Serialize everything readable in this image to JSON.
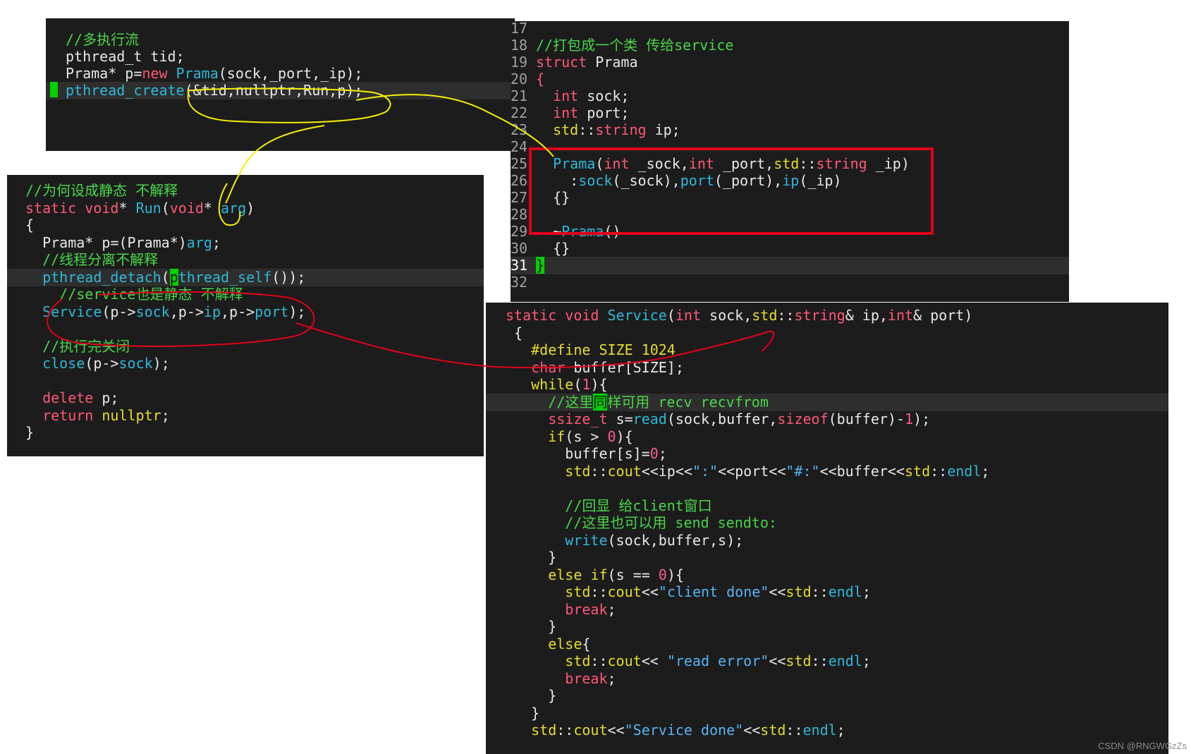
{
  "panels": [
    {
      "id": "panel-main-thread",
      "gutter": false,
      "lines": [
        {
          "tokens": [
            [
              "cm",
              "//多执行流"
            ]
          ],
          "indent": 0
        },
        {
          "tokens": [
            [
              "t",
              "pthread_t tid;"
            ]
          ],
          "indent": 0
        },
        {
          "tokens": [
            [
              "t",
              "Prama* p="
            ],
            [
              "ty",
              "new"
            ],
            [
              "t",
              " "
            ],
            [
              "fn",
              "Prama"
            ],
            [
              "t",
              "(sock,_port,_ip);"
            ]
          ],
          "indent": 0
        },
        {
          "tokens": [
            [
              "fn",
              "pthread_create"
            ],
            [
              "t",
              "(&tid,nullptr,Run,p);"
            ]
          ],
          "indent": 0,
          "highlight": true,
          "marker": true
        }
      ]
    },
    {
      "id": "panel-prama-struct",
      "gutter": true,
      "lines": [
        {
          "num": "17",
          "tokens": []
        },
        {
          "num": "18",
          "tokens": [
            [
              "cm",
              "//打包成一个类 传给service"
            ]
          ]
        },
        {
          "num": "19",
          "tokens": [
            [
              "ty",
              "struct"
            ],
            [
              "t",
              " Prama"
            ]
          ]
        },
        {
          "num": "20",
          "tokens": [
            [
              "ty",
              "{"
            ]
          ]
        },
        {
          "num": "21",
          "tokens": [
            [
              "t",
              "  "
            ],
            [
              "ty",
              "int"
            ],
            [
              "t",
              " sock;"
            ]
          ]
        },
        {
          "num": "22",
          "tokens": [
            [
              "t",
              "  "
            ],
            [
              "ty",
              "int"
            ],
            [
              "t",
              " port;"
            ]
          ]
        },
        {
          "num": "23",
          "tokens": [
            [
              "t",
              "  "
            ],
            [
              "kw",
              "std"
            ],
            [
              "t",
              "::"
            ],
            [
              "ty",
              "string"
            ],
            [
              "t",
              " ip;"
            ]
          ]
        },
        {
          "num": "24",
          "tokens": []
        },
        {
          "num": "25",
          "tokens": [
            [
              "t",
              "  "
            ],
            [
              "fn",
              "Prama"
            ],
            [
              "t",
              "("
            ],
            [
              "ty",
              "int"
            ],
            [
              "t",
              " _sock,"
            ],
            [
              "ty",
              "int"
            ],
            [
              "t",
              " _port,"
            ],
            [
              "kw",
              "std"
            ],
            [
              "t",
              "::"
            ],
            [
              "ty",
              "string"
            ],
            [
              "t",
              " _ip)"
            ]
          ]
        },
        {
          "num": "26",
          "tokens": [
            [
              "t",
              "    :"
            ],
            [
              "fn",
              "sock"
            ],
            [
              "t",
              "(_sock),"
            ],
            [
              "fn",
              "port"
            ],
            [
              "t",
              "(_port),"
            ],
            [
              "fn",
              "ip"
            ],
            [
              "t",
              "(_ip)"
            ]
          ]
        },
        {
          "num": "27",
          "tokens": [
            [
              "t",
              "  {}"
            ]
          ]
        },
        {
          "num": "28",
          "tokens": []
        },
        {
          "num": "29",
          "tokens": [
            [
              "t",
              "  ~"
            ],
            [
              "fn",
              "Prama"
            ],
            [
              "t",
              "()"
            ]
          ]
        },
        {
          "num": "30",
          "tokens": [
            [
              "t",
              "  {}"
            ]
          ]
        },
        {
          "num": "31",
          "tokens": [
            [
              "cur",
              "}"
            ]
          ],
          "highlight": true,
          "numHighlight": true
        },
        {
          "num": "32",
          "tokens": []
        }
      ]
    },
    {
      "id": "panel-run-function",
      "gutter": false,
      "lines": [
        {
          "tokens": [
            [
              "cm",
              "//为何设成静态 不解释"
            ]
          ]
        },
        {
          "tokens": [
            [
              "ty",
              "static"
            ],
            [
              "t",
              " "
            ],
            [
              "ty",
              "void"
            ],
            [
              "t",
              "* "
            ],
            [
              "fn",
              "Run"
            ],
            [
              "t",
              "("
            ],
            [
              "ty",
              "void"
            ],
            [
              "t",
              "* "
            ],
            [
              "fn",
              "arg"
            ],
            [
              "t",
              ")"
            ]
          ]
        },
        {
          "tokens": [
            [
              "t",
              "{"
            ]
          ]
        },
        {
          "tokens": [
            [
              "t",
              "  Prama* p=(Prama*)"
            ],
            [
              "fn",
              "arg"
            ],
            [
              "t",
              ";"
            ]
          ]
        },
        {
          "tokens": [
            [
              "t",
              "  "
            ],
            [
              "cm",
              "//线程分离不解释"
            ]
          ]
        },
        {
          "tokens": [
            [
              "t",
              "  "
            ],
            [
              "fn",
              "pthread_detach"
            ],
            [
              "t",
              "("
            ],
            [
              "cur",
              "p"
            ],
            [
              "fn",
              "thread_self"
            ],
            [
              "t",
              "());"
            ]
          ],
          "highlight": true
        },
        {
          "tokens": [
            [
              "t",
              "    "
            ],
            [
              "cm",
              "//service也是静态 不解释"
            ]
          ]
        },
        {
          "tokens": [
            [
              "t",
              "  "
            ],
            [
              "fn",
              "Service"
            ],
            [
              "t",
              "(p->"
            ],
            [
              "fn",
              "sock"
            ],
            [
              "t",
              ",p->"
            ],
            [
              "fn",
              "ip"
            ],
            [
              "t",
              ",p->"
            ],
            [
              "fn",
              "port"
            ],
            [
              "t",
              ");"
            ]
          ]
        },
        {
          "tokens": []
        },
        {
          "tokens": [
            [
              "t",
              "  "
            ],
            [
              "cm",
              "//执行完关闭"
            ]
          ]
        },
        {
          "tokens": [
            [
              "t",
              "  "
            ],
            [
              "fn",
              "close"
            ],
            [
              "t",
              "(p->"
            ],
            [
              "fn",
              "sock"
            ],
            [
              "t",
              ");"
            ]
          ]
        },
        {
          "tokens": []
        },
        {
          "tokens": [
            [
              "t",
              "  "
            ],
            [
              "ty",
              "delete"
            ],
            [
              "t",
              " p;"
            ]
          ]
        },
        {
          "tokens": [
            [
              "t",
              "  "
            ],
            [
              "ty",
              "return"
            ],
            [
              "t",
              " "
            ],
            [
              "kw",
              "nullptr"
            ],
            [
              "t",
              ";"
            ]
          ]
        },
        {
          "tokens": [
            [
              "t",
              "}"
            ]
          ]
        }
      ]
    },
    {
      "id": "panel-service-function",
      "gutter": false,
      "lines": [
        {
          "tokens": [
            [
              "ty",
              "static"
            ],
            [
              "t",
              " "
            ],
            [
              "ty",
              "void"
            ],
            [
              "t",
              " "
            ],
            [
              "fn",
              "Service"
            ],
            [
              "t",
              "("
            ],
            [
              "ty",
              "int"
            ],
            [
              "t",
              " sock,"
            ],
            [
              "kw",
              "std"
            ],
            [
              "t",
              "::"
            ],
            [
              "ty",
              "string"
            ],
            [
              "t",
              "& ip,"
            ],
            [
              "ty",
              "int"
            ],
            [
              "t",
              "& port)"
            ]
          ]
        },
        {
          "tokens": [
            [
              "t",
              " {"
            ]
          ]
        },
        {
          "tokens": [
            [
              "t",
              "   "
            ],
            [
              "kw",
              "#define"
            ],
            [
              "t",
              " "
            ],
            [
              "kw",
              "SIZE"
            ],
            [
              "t",
              " "
            ],
            [
              "kw",
              "1024"
            ]
          ]
        },
        {
          "tokens": [
            [
              "t",
              "   "
            ],
            [
              "ty",
              "char"
            ],
            [
              "t",
              " buffer[SIZE];"
            ]
          ]
        },
        {
          "tokens": [
            [
              "t",
              "   "
            ],
            [
              "kw",
              "while"
            ],
            [
              "t",
              "("
            ],
            [
              "nm",
              "1"
            ],
            [
              "t",
              "){"
            ]
          ]
        },
        {
          "tokens": [
            [
              "t",
              "     "
            ],
            [
              "cm",
              "//这里"
            ],
            [
              "cur",
              "同"
            ],
            [
              "cm",
              "样可用 recv recvfrom"
            ]
          ],
          "highlight": true
        },
        {
          "tokens": [
            [
              "t",
              "     "
            ],
            [
              "ty",
              "ssize_t"
            ],
            [
              "t",
              " s="
            ],
            [
              "fn",
              "read"
            ],
            [
              "t",
              "(sock,buffer,"
            ],
            [
              "ty",
              "sizeof"
            ],
            [
              "t",
              "(buffer)-"
            ],
            [
              "nm",
              "1"
            ],
            [
              "t",
              ");"
            ]
          ]
        },
        {
          "tokens": [
            [
              "t",
              "     "
            ],
            [
              "kw",
              "if"
            ],
            [
              "t",
              "(s > "
            ],
            [
              "nm",
              "0"
            ],
            [
              "t",
              "){"
            ]
          ]
        },
        {
          "tokens": [
            [
              "t",
              "       buffer[s]="
            ],
            [
              "nm",
              "0"
            ],
            [
              "t",
              ";"
            ]
          ]
        },
        {
          "tokens": [
            [
              "t",
              "       "
            ],
            [
              "kw",
              "std"
            ],
            [
              "t",
              "::"
            ],
            [
              "kw",
              "cout"
            ],
            [
              "t",
              "<<ip<<"
            ],
            [
              "st",
              "\":\""
            ],
            [
              "t",
              "<<port<<"
            ],
            [
              "st",
              "\"#:\""
            ],
            [
              "t",
              "<<buffer<<"
            ],
            [
              "kw",
              "std"
            ],
            [
              "t",
              "::"
            ],
            [
              "fn",
              "endl"
            ],
            [
              "t",
              ";"
            ]
          ]
        },
        {
          "tokens": []
        },
        {
          "tokens": [
            [
              "t",
              "       "
            ],
            [
              "cm",
              "//回显 给client窗口"
            ]
          ]
        },
        {
          "tokens": [
            [
              "t",
              "       "
            ],
            [
              "cm",
              "//这里也可以用 send sendto:"
            ]
          ]
        },
        {
          "tokens": [
            [
              "t",
              "       "
            ],
            [
              "fn",
              "write"
            ],
            [
              "t",
              "(sock,buffer,s);"
            ]
          ]
        },
        {
          "tokens": [
            [
              "t",
              "     }"
            ]
          ]
        },
        {
          "tokens": [
            [
              "t",
              "     "
            ],
            [
              "kw",
              "else"
            ],
            [
              "t",
              " "
            ],
            [
              "kw",
              "if"
            ],
            [
              "t",
              "(s == "
            ],
            [
              "nm",
              "0"
            ],
            [
              "t",
              "){"
            ]
          ]
        },
        {
          "tokens": [
            [
              "t",
              "       "
            ],
            [
              "kw",
              "std"
            ],
            [
              "t",
              "::"
            ],
            [
              "kw",
              "cout"
            ],
            [
              "t",
              "<<"
            ],
            [
              "st",
              "\"client done\""
            ],
            [
              "t",
              "<<"
            ],
            [
              "kw",
              "std"
            ],
            [
              "t",
              "::"
            ],
            [
              "fn",
              "endl"
            ],
            [
              "t",
              ";"
            ]
          ]
        },
        {
          "tokens": [
            [
              "t",
              "       "
            ],
            [
              "ty",
              "break"
            ],
            [
              "t",
              ";"
            ]
          ]
        },
        {
          "tokens": [
            [
              "t",
              "     }"
            ]
          ]
        },
        {
          "tokens": [
            [
              "t",
              "     "
            ],
            [
              "kw",
              "else"
            ],
            [
              "t",
              "{"
            ]
          ]
        },
        {
          "tokens": [
            [
              "t",
              "       "
            ],
            [
              "kw",
              "std"
            ],
            [
              "t",
              "::"
            ],
            [
              "kw",
              "cout"
            ],
            [
              "t",
              "<< "
            ],
            [
              "st",
              "\"read error\""
            ],
            [
              "t",
              "<<"
            ],
            [
              "kw",
              "std"
            ],
            [
              "t",
              "::"
            ],
            [
              "fn",
              "endl"
            ],
            [
              "t",
              ";"
            ]
          ]
        },
        {
          "tokens": [
            [
              "t",
              "       "
            ],
            [
              "ty",
              "break"
            ],
            [
              "t",
              ";"
            ]
          ]
        },
        {
          "tokens": [
            [
              "t",
              "     }"
            ]
          ]
        },
        {
          "tokens": [
            [
              "t",
              "   }"
            ]
          ]
        },
        {
          "tokens": [
            [
              "t",
              "   "
            ],
            [
              "kw",
              "std"
            ],
            [
              "t",
              "::"
            ],
            [
              "kw",
              "cout"
            ],
            [
              "t",
              "<<"
            ],
            [
              "st",
              "\"Service done\""
            ],
            [
              "t",
              "<<"
            ],
            [
              "kw",
              "std"
            ],
            [
              "t",
              "::"
            ],
            [
              "fn",
              "endl"
            ],
            [
              "t",
              ";"
            ]
          ]
        }
      ]
    }
  ],
  "watermark": "CSDN @RNGWGzZs",
  "annotation_colors": {
    "yellow": "#f5f000",
    "red": "#e0001a"
  }
}
